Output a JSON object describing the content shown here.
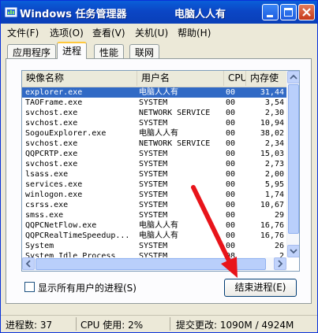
{
  "window": {
    "title": "Windows 任务管理器",
    "title_overlay": "电脑人人有",
    "controls": {
      "minimize": "minimize",
      "maximize": "maximize",
      "close": "close"
    }
  },
  "menubar": [
    "文件(F)",
    "选项(O)",
    "查看(V)",
    "关机(U)",
    "帮助(H)"
  ],
  "tabs": [
    {
      "label": "应用程序",
      "active": false
    },
    {
      "label": "进程",
      "active": true
    },
    {
      "label": "性能",
      "active": false
    },
    {
      "label": "联网",
      "active": false
    }
  ],
  "columns": [
    "映像名称",
    "用户名",
    "CPU",
    "内存使"
  ],
  "processes": [
    {
      "name": "explorer.exe",
      "user": "电脑人人有",
      "cpu": "00",
      "mem": "31,44",
      "selected": true
    },
    {
      "name": "TAOFrame.exe",
      "user": "SYSTEM",
      "cpu": "00",
      "mem": "3,54"
    },
    {
      "name": "svchost.exe",
      "user": "NETWORK SERVICE",
      "cpu": "00",
      "mem": "2,30"
    },
    {
      "name": "svchost.exe",
      "user": "SYSTEM",
      "cpu": "00",
      "mem": "10,94"
    },
    {
      "name": "SogouExplorer.exe",
      "user": "电脑人人有",
      "cpu": "00",
      "mem": "38,02"
    },
    {
      "name": "svchost.exe",
      "user": "NETWORK SERVICE",
      "cpu": "00",
      "mem": "2,34"
    },
    {
      "name": "QQPCRTP.exe",
      "user": "SYSTEM",
      "cpu": "00",
      "mem": "15,03"
    },
    {
      "name": "svchost.exe",
      "user": "SYSTEM",
      "cpu": "00",
      "mem": "2,73"
    },
    {
      "name": "lsass.exe",
      "user": "SYSTEM",
      "cpu": "00",
      "mem": "2,00"
    },
    {
      "name": "services.exe",
      "user": "SYSTEM",
      "cpu": "00",
      "mem": "5,95"
    },
    {
      "name": "winlogon.exe",
      "user": "SYSTEM",
      "cpu": "00",
      "mem": "1,74"
    },
    {
      "name": "csrss.exe",
      "user": "SYSTEM",
      "cpu": "00",
      "mem": "10,67"
    },
    {
      "name": "smss.exe",
      "user": "SYSTEM",
      "cpu": "00",
      "mem": "29"
    },
    {
      "name": "QQPCNetFlow.exe",
      "user": "电脑人人有",
      "cpu": "00",
      "mem": "16,76"
    },
    {
      "name": "QQPCRealTimeSpeedup...",
      "user": "电脑人人有",
      "cpu": "00",
      "mem": "16,76"
    },
    {
      "name": "System",
      "user": "SYSTEM",
      "cpu": "00",
      "mem": "26"
    },
    {
      "name": "System Idle Process",
      "user": "SYSTEM",
      "cpu": "98",
      "mem": "2"
    }
  ],
  "show_all_users": {
    "label": "显示所有用户的进程(S)",
    "checked": false
  },
  "end_process_button": "结束进程(E)",
  "status": {
    "processes": "进程数: 37",
    "cpu": "CPU 使用: 2%",
    "commit": "提交更改: 1090M / 4924M"
  },
  "colors": {
    "titlebar": "#0b46c5",
    "selection": "#316ac5",
    "annotation_arrow": "#e8141a"
  }
}
